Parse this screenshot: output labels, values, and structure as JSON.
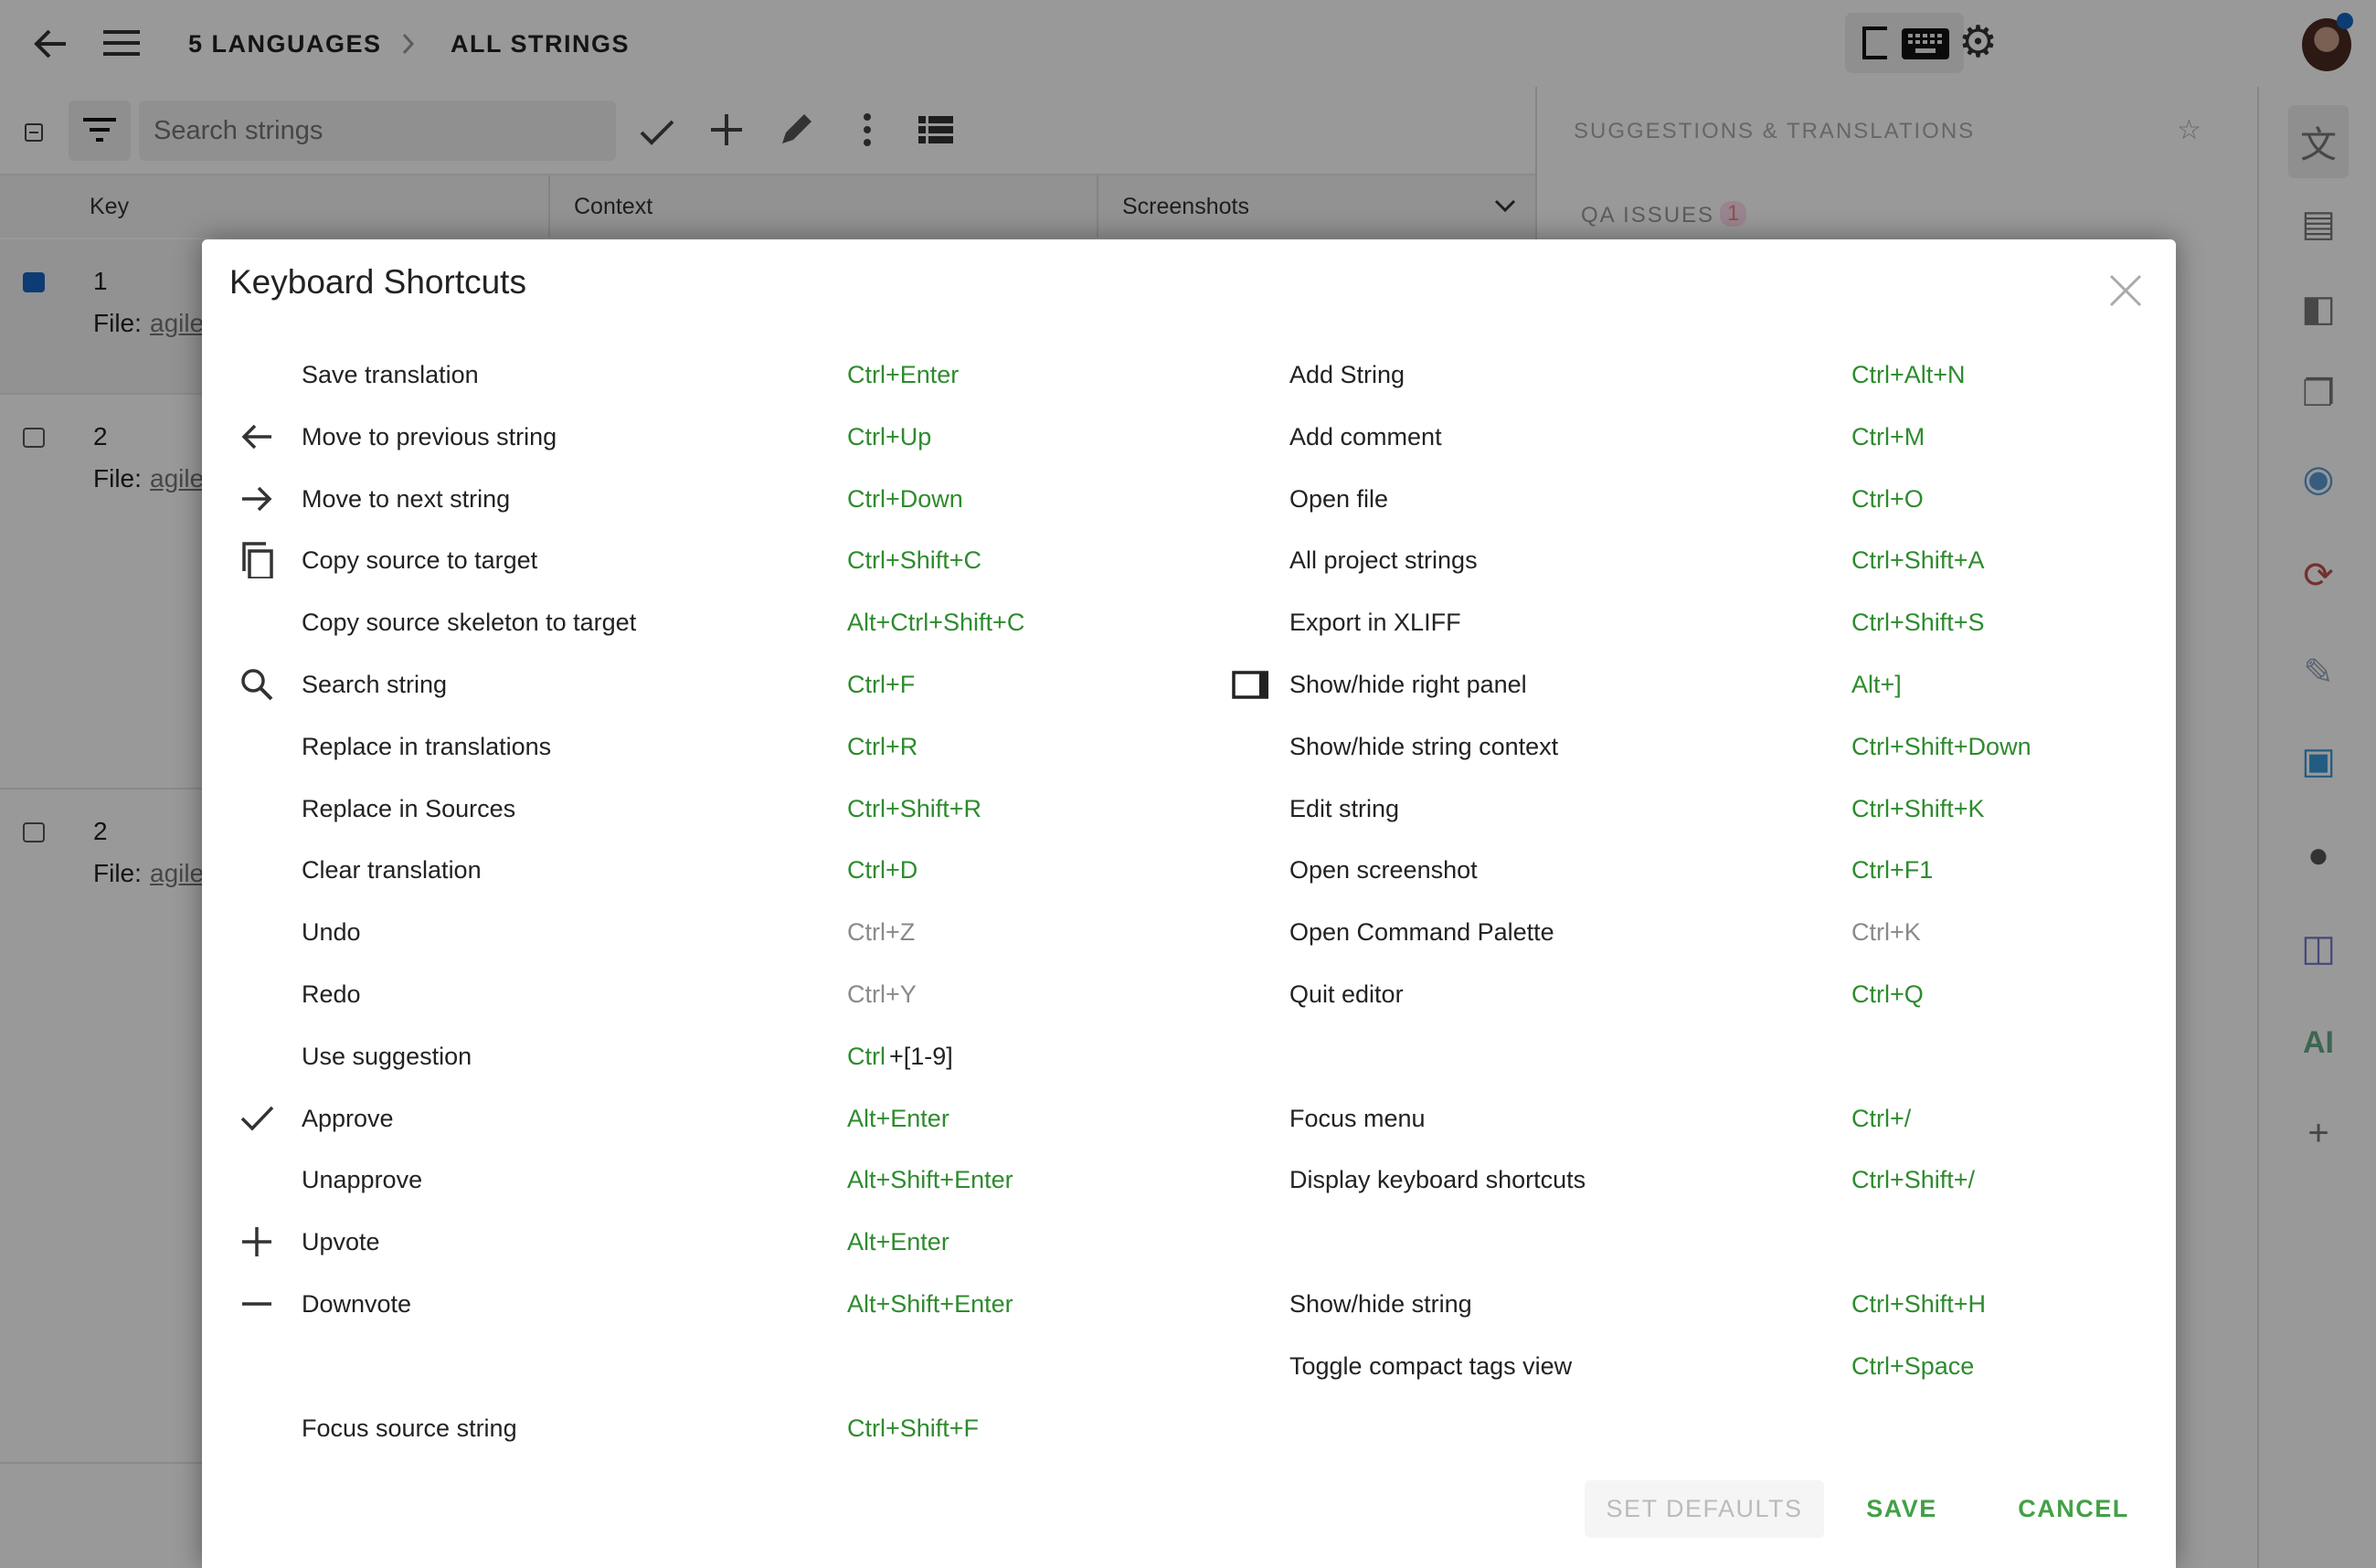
{
  "topbar": {
    "breadcrumb": [
      "5 LANGUAGES",
      "ALL STRINGS"
    ],
    "icons": [
      "back-arrow-icon",
      "menu-icon",
      "toggle-right-panel-icon",
      "keyboard-icon",
      "gear-icon",
      "avatar"
    ],
    "notification_color": "#1565c0"
  },
  "toolbar": {
    "search_placeholder": "Search strings"
  },
  "columns": [
    "Key",
    "Context",
    "Screenshots"
  ],
  "rows": [
    {
      "id": "1",
      "file_label": "File:",
      "file": "agile",
      "checked": true
    },
    {
      "id": "2",
      "file_label": "File:",
      "file": "agile",
      "checked": false
    },
    {
      "id": "2",
      "file_label": "File:",
      "file": "agile",
      "checked": false
    }
  ],
  "right_panel": {
    "title": "SUGGESTIONS & TRANSLATIONS",
    "qa_label": "QA ISSUES",
    "qa_count": "1"
  },
  "sidebar_icons": [
    "translate-icon",
    "comment-icon",
    "sidebar-icon",
    "tm-icon",
    "preview-icon",
    "sync-icon",
    "notes-icon",
    "screenshot-icon",
    "chat-icon",
    "split-icon",
    "ai-icon",
    "add-icon"
  ],
  "modal": {
    "title": "Keyboard Shortcuts",
    "left": [
      {
        "label": "Save translation",
        "shortcut": "Ctrl+Enter"
      },
      {
        "label": "Move to previous string",
        "shortcut": "Ctrl+Up",
        "icon": "arrow-left-icon"
      },
      {
        "label": "Move to next string",
        "shortcut": "Ctrl+Down",
        "icon": "arrow-right-icon"
      },
      {
        "label": "Copy source to target",
        "shortcut": "Ctrl+Shift+C",
        "icon": "copy-icon"
      },
      {
        "label": "Copy source skeleton to target",
        "shortcut": "Alt+Ctrl+Shift+C"
      },
      {
        "label": "Search string",
        "shortcut": "Ctrl+F",
        "icon": "search-icon"
      },
      {
        "label": "Replace in translations",
        "shortcut": "Ctrl+R"
      },
      {
        "label": "Replace in Sources",
        "shortcut": "Ctrl+Shift+R"
      },
      {
        "label": "Clear translation",
        "shortcut": "Ctrl+D"
      },
      {
        "label": "Undo",
        "shortcut": "Ctrl+Z",
        "disabled": true
      },
      {
        "label": "Redo",
        "shortcut": "Ctrl+Y",
        "disabled": true
      },
      {
        "label": "Use suggestion",
        "shortcut": "Ctrl",
        "shortcut_suffix": "+[1-9]"
      },
      {
        "label": "Approve",
        "shortcut": "Alt+Enter",
        "icon": "check-icon"
      },
      {
        "label": "Unapprove",
        "shortcut": "Alt+Shift+Enter"
      },
      {
        "label": "Upvote",
        "shortcut": "Alt+Enter",
        "icon": "plus-icon"
      },
      {
        "label": "Downvote",
        "shortcut": "Alt+Shift+Enter",
        "icon": "minus-icon"
      },
      null,
      {
        "label": "Focus source string",
        "shortcut": "Ctrl+Shift+F"
      }
    ],
    "right": [
      {
        "label": "Add String",
        "shortcut": "Ctrl+Alt+N"
      },
      {
        "label": "Add comment",
        "shortcut": "Ctrl+M"
      },
      {
        "label": "Open file",
        "shortcut": "Ctrl+O"
      },
      {
        "label": "All project strings",
        "shortcut": "Ctrl+Shift+A"
      },
      {
        "label": "Export in XLIFF",
        "shortcut": "Ctrl+Shift+S"
      },
      {
        "label": "Show/hide right panel",
        "shortcut": "Alt+]",
        "icon": "right-panel-icon"
      },
      {
        "label": "Show/hide string context",
        "shortcut": "Ctrl+Shift+Down"
      },
      {
        "label": "Edit string",
        "shortcut": "Ctrl+Shift+K"
      },
      {
        "label": "Open screenshot",
        "shortcut": "Ctrl+F1"
      },
      {
        "label": "Open Command Palette",
        "shortcut": "Ctrl+K",
        "disabled": true
      },
      {
        "label": "Quit editor",
        "shortcut": "Ctrl+Q"
      },
      null,
      {
        "label": "Focus menu",
        "shortcut": "Ctrl+/"
      },
      {
        "label": "Display keyboard shortcuts",
        "shortcut": "Ctrl+Shift+/"
      },
      null,
      {
        "label": "Show/hide string",
        "shortcut": "Ctrl+Shift+H"
      },
      {
        "label": "Toggle compact tags view",
        "shortcut": "Ctrl+Space"
      }
    ],
    "buttons": {
      "set_defaults": "SET DEFAULTS",
      "save": "SAVE",
      "cancel": "CANCEL"
    },
    "colors": {
      "shortcut": "#2e8b2e",
      "button": "#43a047",
      "disabled": "#8a8a8a"
    }
  }
}
